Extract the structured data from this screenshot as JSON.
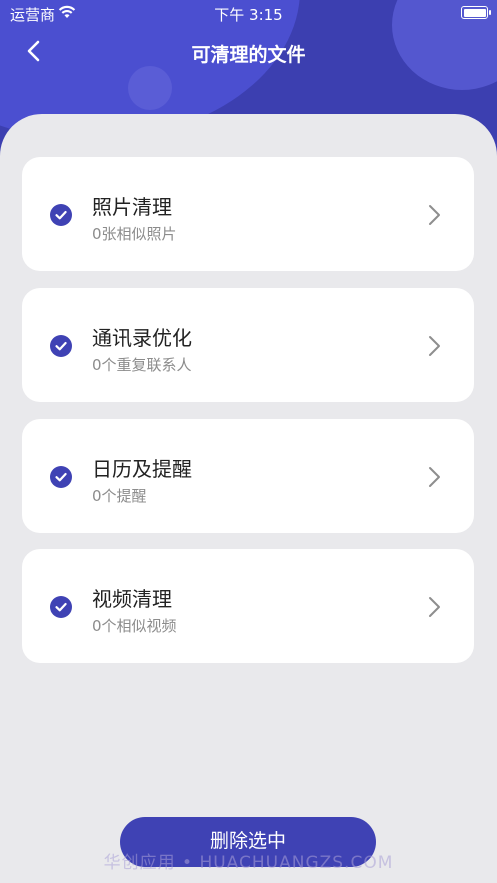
{
  "status_bar": {
    "carrier": "运营商",
    "time": "下午 3:15"
  },
  "nav": {
    "title": "可清理的文件",
    "back_icon": "chevron-left-icon"
  },
  "items": [
    {
      "title": "照片清理",
      "subtitle": "0张相似照片",
      "checked": true
    },
    {
      "title": "通讯录优化",
      "subtitle": "0个重复联系人",
      "checked": true
    },
    {
      "title": "日历及提醒",
      "subtitle": "0个提醒",
      "checked": true
    },
    {
      "title": "视频清理",
      "subtitle": "0个相似视频",
      "checked": true
    }
  ],
  "footer": {
    "delete_label": "删除选中",
    "watermark": "华创应用 • HUACHUANGZS.COM"
  },
  "colors": {
    "header": "#3c3fb0",
    "accent": "#3f42b4",
    "background": "#e9e9ec"
  }
}
